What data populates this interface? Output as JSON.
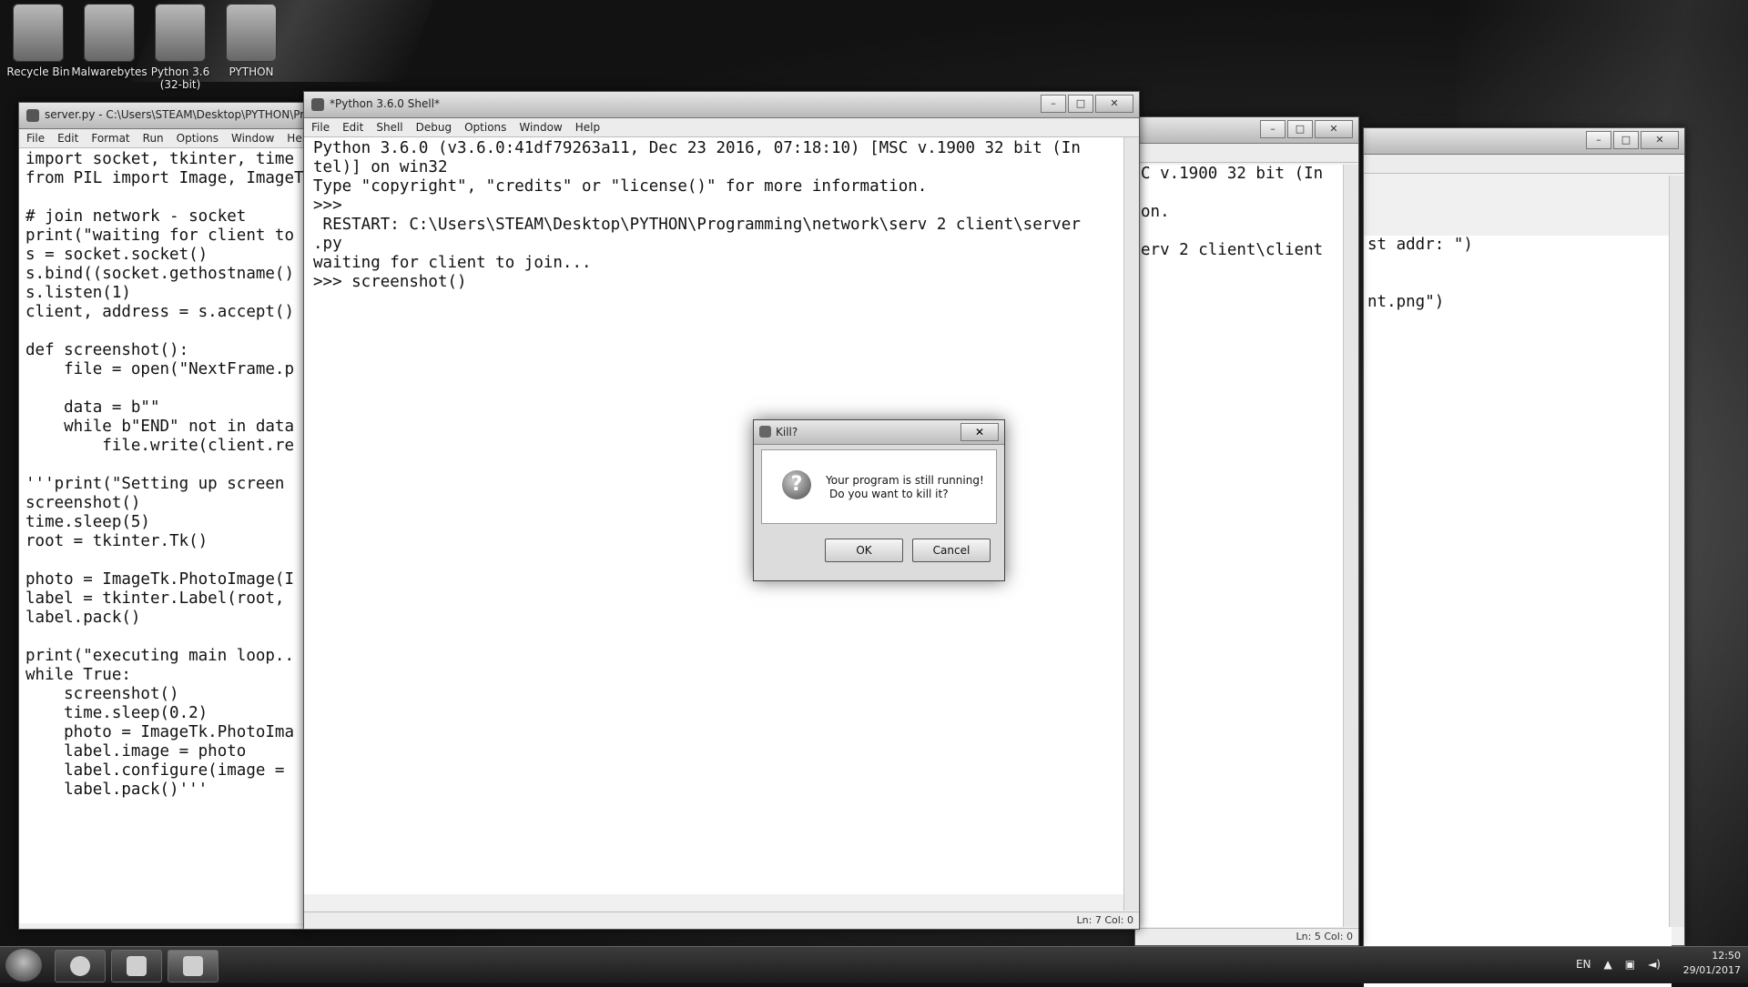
{
  "desktop": {
    "icons": [
      {
        "label": "Recycle Bin"
      },
      {
        "label": "Malwarebytes"
      },
      {
        "label": "Python 3.6 (32-bit)"
      },
      {
        "label": "PYTHON"
      }
    ]
  },
  "editor_window": {
    "title": "server.py - C:\\Users\\STEAM\\Desktop\\PYTHON\\Programming",
    "menu": [
      "File",
      "Edit",
      "Format",
      "Run",
      "Options",
      "Window",
      "Help"
    ],
    "code": "import socket, tkinter, time\nfrom PIL import Image, ImageTk\n\n# join network - socket\nprint(\"waiting for client to\ns = socket.socket()\ns.bind((socket.gethostname()\ns.listen(1)\nclient, address = s.accept()\n\ndef screenshot():\n    file = open(\"NextFrame.p\n\n    data = b\"\"\n    while b\"END\" not in data\n        file.write(client.re\n\n'''print(\"Setting up screen\nscreenshot()\ntime.sleep(5)\nroot = tkinter.Tk()\n\nphoto = ImageTk.PhotoImage(I\nlabel = tkinter.Label(root,\nlabel.pack()\n\nprint(\"executing main loop..\nwhile True:\n    screenshot()\n    time.sleep(0.2)\n    photo = ImageTk.PhotoIma\n    label.image = photo\n    label.configure(image =\n    label.pack()'''"
  },
  "shell_window": {
    "title": "*Python 3.6.0 Shell*",
    "menu": [
      "File",
      "Edit",
      "Shell",
      "Debug",
      "Options",
      "Window",
      "Help"
    ],
    "output": "Python 3.6.0 (v3.6.0:41df79263a11, Dec 23 2016, 07:18:10) [MSC v.1900 32 bit (In\ntel)] on win32\nType \"copyright\", \"credits\" or \"license()\" for more information.\n>>>\n RESTART: C:\\Users\\STEAM\\Desktop\\PYTHON\\Programming\\network\\serv 2 client\\server\n.py\nwaiting for client to join...\n>>> screenshot()",
    "status": "Ln: 7   Col: 0"
  },
  "back_window_1": {
    "output": "C v.1900 32 bit (In\n\non.\n\nerv 2 client\\client",
    "status": "Ln: 5   Col: 0"
  },
  "back_window_2": {
    "output": "st addr: \")\n\n\nnt.png\")"
  },
  "dialog": {
    "title": "Kill?",
    "message_line1": "Your program is still running!",
    "message_line2": "Do you want to kill it?",
    "ok_label": "OK",
    "cancel_label": "Cancel",
    "icon": "question-icon"
  },
  "taskbar": {
    "language": "EN",
    "time": "12:50",
    "date": "29/01/2017"
  }
}
